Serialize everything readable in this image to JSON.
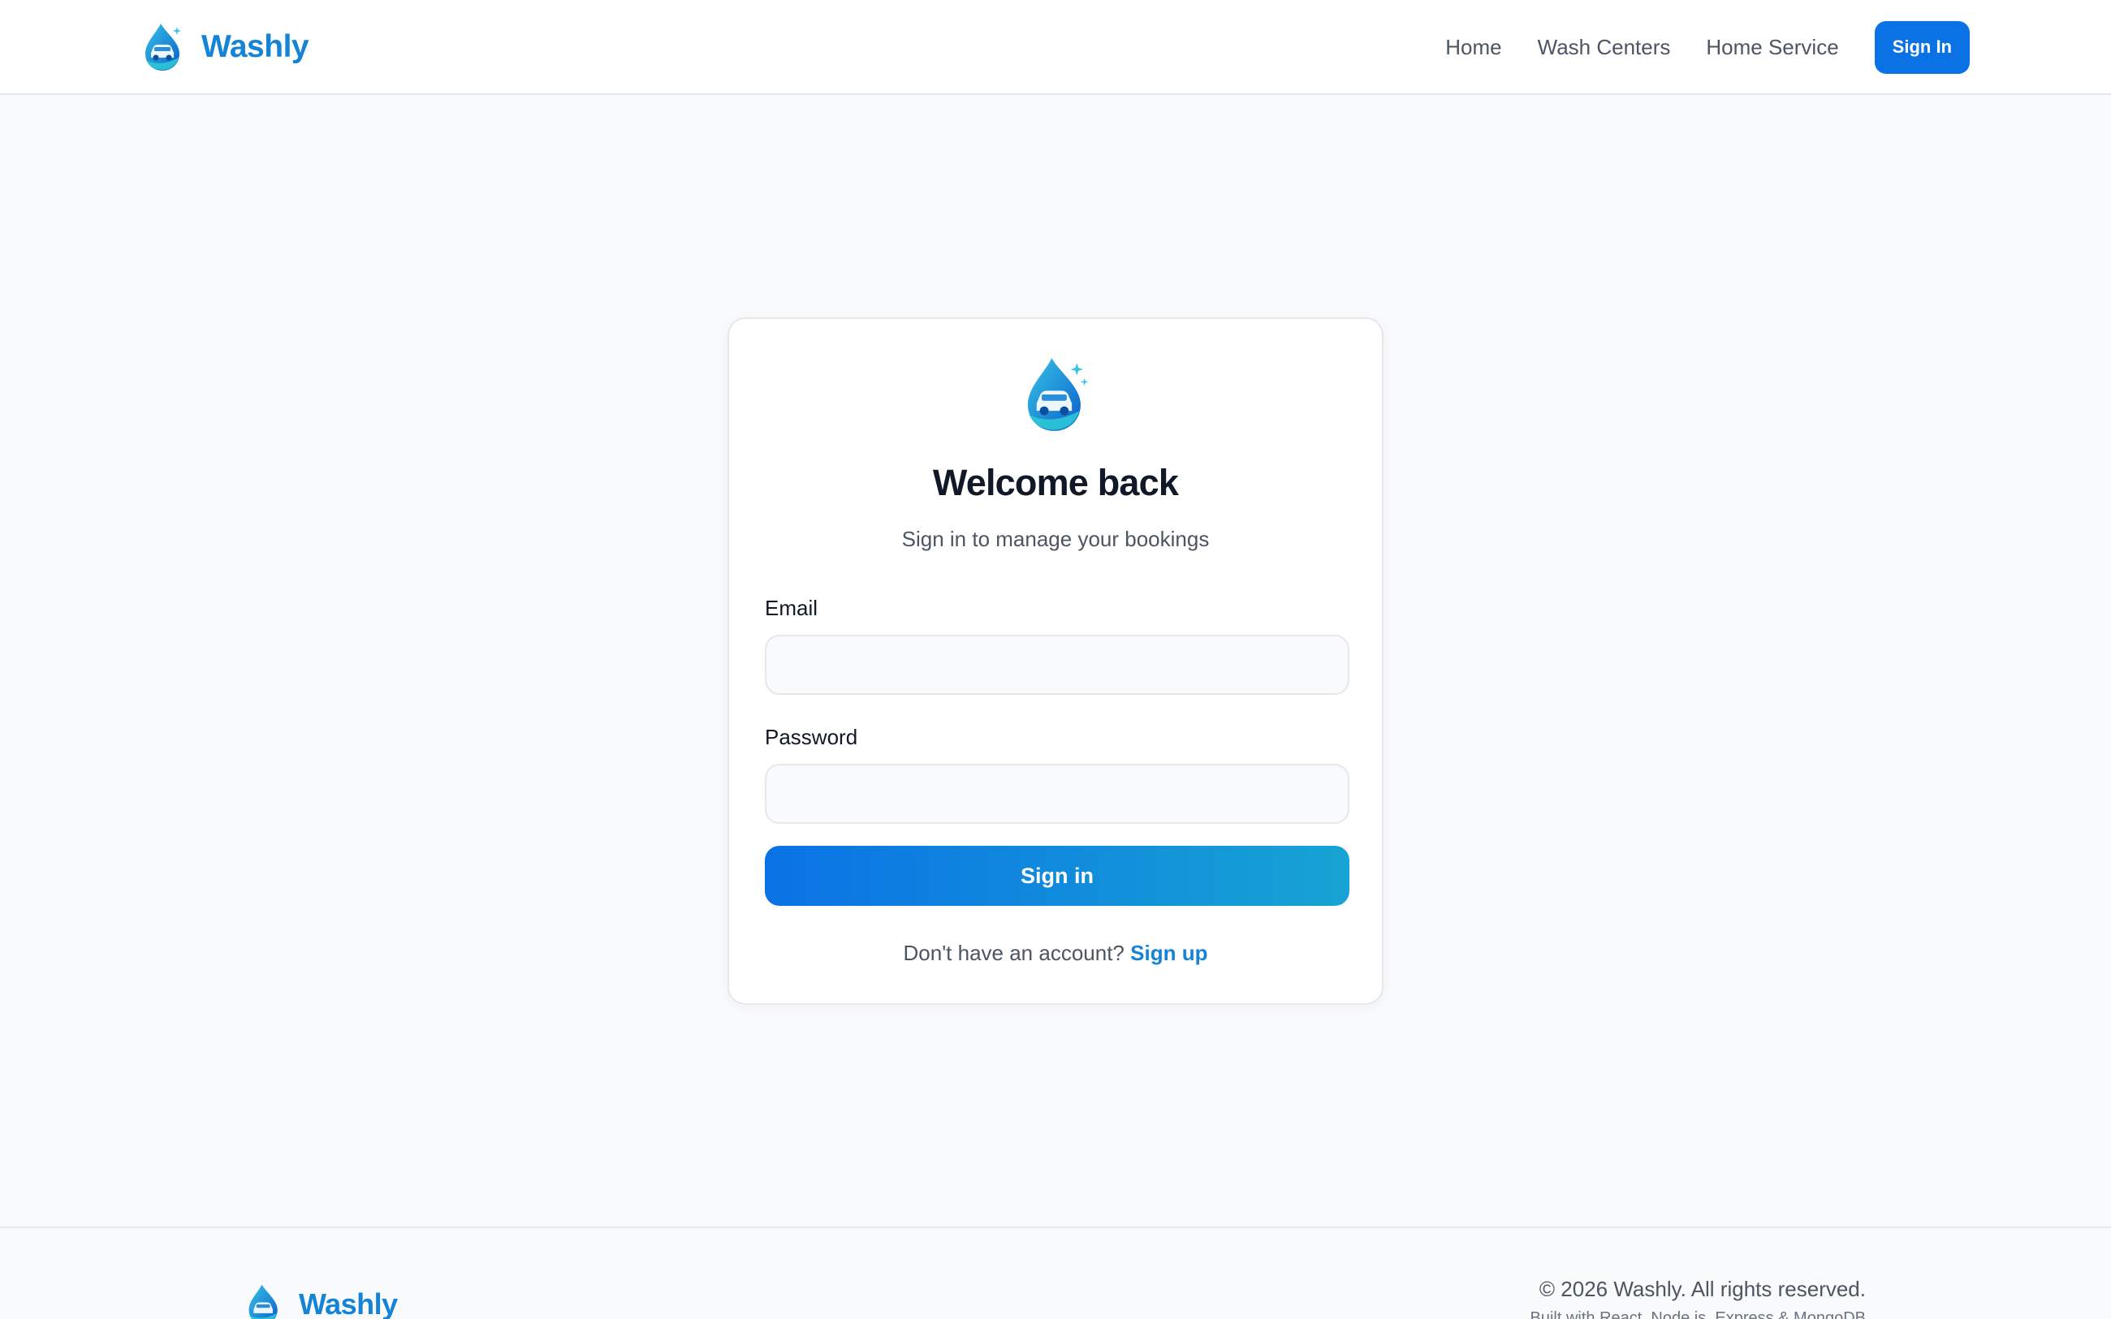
{
  "header": {
    "brand_name": "Washly",
    "nav": [
      "Home",
      "Wash Centers",
      "Home Service"
    ],
    "signin_label": "Sign In"
  },
  "login": {
    "title": "Welcome back",
    "subtitle": "Sign in to manage your bookings",
    "email_label": "Email",
    "email_value": "",
    "password_label": "Password",
    "password_value": "",
    "submit_label": "Sign in",
    "signup_prompt": "Don't have an account?",
    "signup_link": "Sign up"
  },
  "footer": {
    "brand_name": "Washly",
    "copyright": "© 2026 Washly. All rights reserved.",
    "built_with": "Built with React, Node.js, Express & MongoDB"
  },
  "colors": {
    "accent": "#0a72e5",
    "brand": "#1583d6",
    "gradient_end": "#17a3d3",
    "background": "#f9fafb"
  },
  "icons": {
    "brand_logo": "water-drop-car-logo-icon"
  }
}
